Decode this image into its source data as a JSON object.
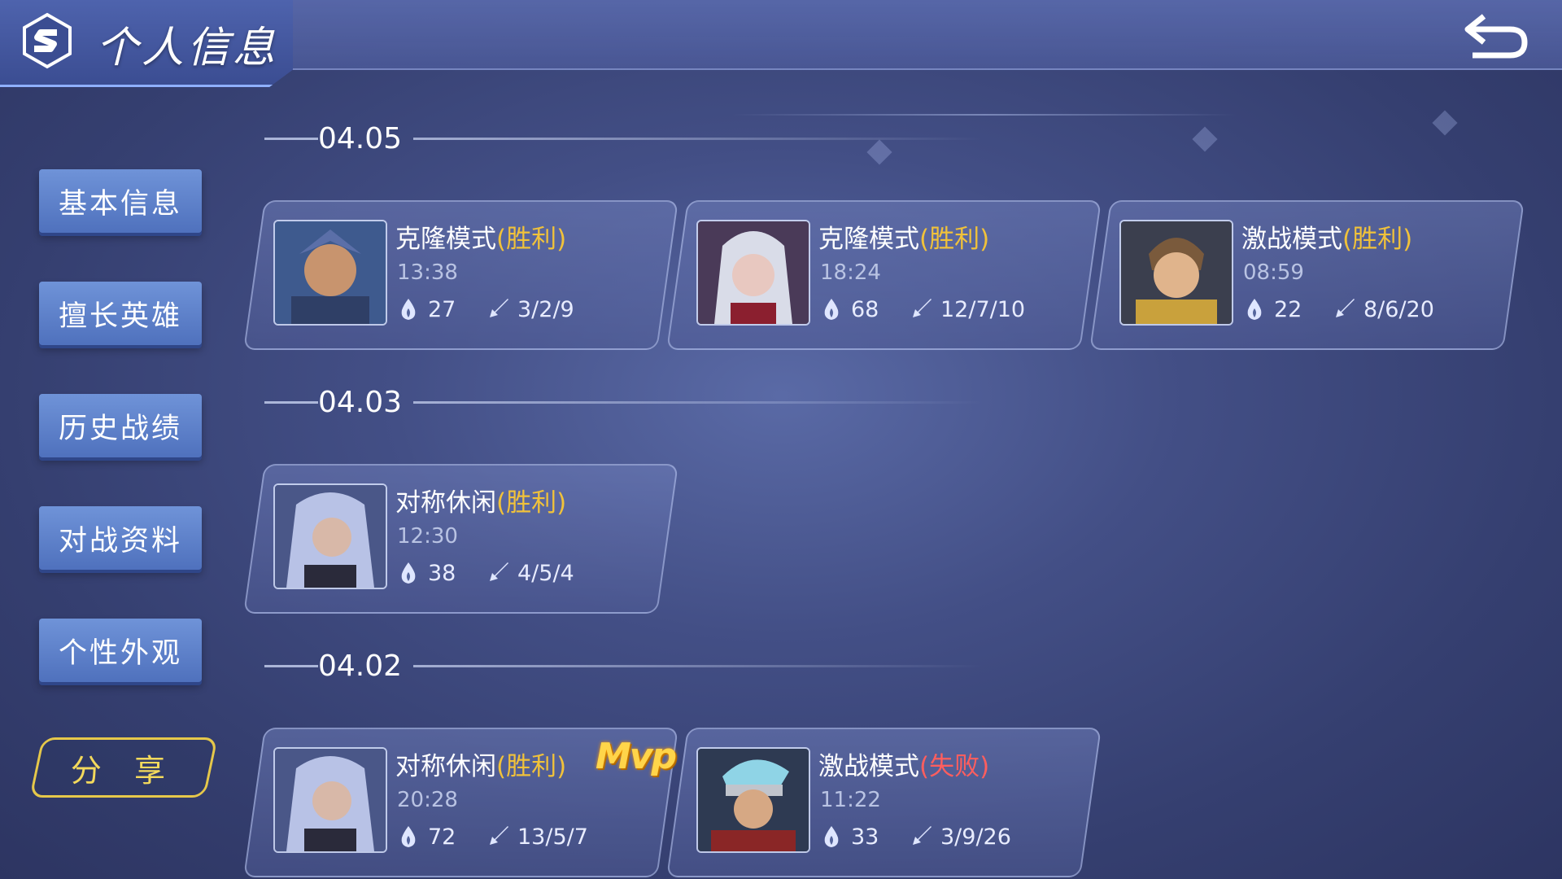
{
  "header": {
    "title": "个人信息",
    "logo": "s-logo-icon",
    "back": "back-arrow-icon"
  },
  "sidebar": {
    "items": [
      {
        "label": "基本信息"
      },
      {
        "label": "擅长英雄"
      },
      {
        "label": "历史战绩"
      },
      {
        "label": "对战资料"
      },
      {
        "label": "个性外观"
      }
    ],
    "share_label": "分 享"
  },
  "groups": [
    {
      "date": "04.05",
      "matches": [
        {
          "mode": "克隆模式",
          "result": "(胜利)",
          "time": "13:38",
          "score": "27",
          "kda": "3/2/9"
        },
        {
          "mode": "克隆模式",
          "result": "(胜利)",
          "time": "18:24",
          "score": "68",
          "kda": "12/7/10"
        },
        {
          "mode": "激战模式",
          "result": "(胜利)",
          "time": "08:59",
          "score": "22",
          "kda": "8/6/20"
        }
      ]
    },
    {
      "date": "04.03",
      "matches": [
        {
          "mode": "对称休闲",
          "result": "(胜利)",
          "time": "12:30",
          "score": "38",
          "kda": "4/5/4"
        }
      ]
    },
    {
      "date": "04.02",
      "matches": [
        {
          "mode": "对称休闲",
          "result": "(胜利)",
          "time": "20:28",
          "score": "72",
          "kda": "13/5/7",
          "badge": "Mvp"
        },
        {
          "mode": "激战模式",
          "result": "(失败)",
          "time": "11:22",
          "score": "33",
          "kda": "3/9/26"
        }
      ]
    }
  ],
  "colors": {
    "win": "#f1c23a",
    "lose": "#ff5e5e",
    "accent": "#6f93d8",
    "share": "#e6c84a"
  },
  "icons": {
    "score": "flame-icon",
    "kda": "sword-icon"
  }
}
